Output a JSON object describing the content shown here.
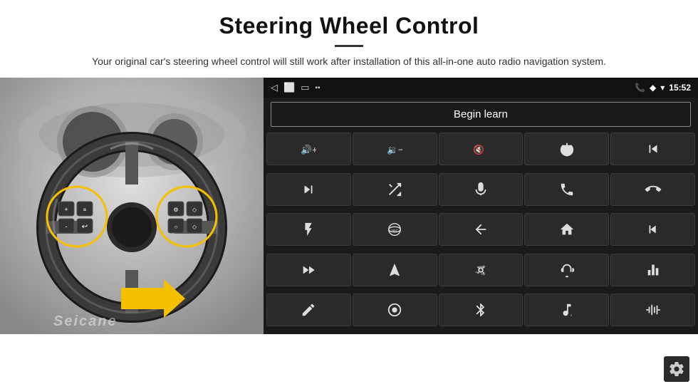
{
  "header": {
    "title": "Steering Wheel Control",
    "description": "Your original car's steering wheel control will still work after installation of this all-in-one auto radio navigation system."
  },
  "statusbar": {
    "time": "15:52"
  },
  "begin_learn": {
    "label": "Begin learn"
  },
  "watermark": "Seicane",
  "controls": [
    {
      "id": "vol-up",
      "icon": "vol_up"
    },
    {
      "id": "vol-down",
      "icon": "vol_down"
    },
    {
      "id": "vol-mute",
      "icon": "vol_mute"
    },
    {
      "id": "power",
      "icon": "power"
    },
    {
      "id": "prev-track",
      "icon": "prev_track"
    },
    {
      "id": "next",
      "icon": "next"
    },
    {
      "id": "shuffle",
      "icon": "shuffle"
    },
    {
      "id": "mic",
      "icon": "mic"
    },
    {
      "id": "phone",
      "icon": "phone"
    },
    {
      "id": "hang-up",
      "icon": "hang_up"
    },
    {
      "id": "flashlight",
      "icon": "flashlight"
    },
    {
      "id": "360view",
      "icon": "360view"
    },
    {
      "id": "back",
      "icon": "back"
    },
    {
      "id": "home",
      "icon": "home"
    },
    {
      "id": "skip-back",
      "icon": "skip_back"
    },
    {
      "id": "fast-forward",
      "icon": "fast_forward"
    },
    {
      "id": "navigate",
      "icon": "navigate"
    },
    {
      "id": "switch",
      "icon": "switch"
    },
    {
      "id": "record",
      "icon": "record"
    },
    {
      "id": "equalizer",
      "icon": "equalizer"
    },
    {
      "id": "pencil",
      "icon": "pencil"
    },
    {
      "id": "circle-dot",
      "icon": "circle_dot"
    },
    {
      "id": "bluetooth",
      "icon": "bluetooth"
    },
    {
      "id": "music",
      "icon": "music"
    },
    {
      "id": "waveform",
      "icon": "waveform"
    }
  ]
}
